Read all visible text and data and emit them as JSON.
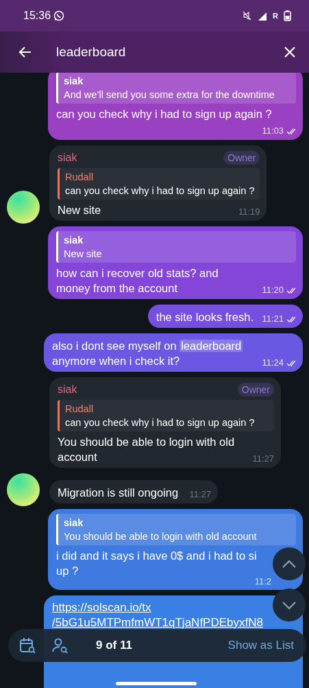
{
  "status_bar": {
    "time": "15:36",
    "carrier": "R"
  },
  "search": {
    "value": "leaderboard"
  },
  "messages": [
    {
      "kind": "outgoing",
      "color": "#9a40c2",
      "reply": {
        "name": "siak",
        "text": "And we’ll send you some extra for the downtime"
      },
      "text": "can you check why i had to sign up again ?",
      "time": "11:03",
      "read": true
    },
    {
      "kind": "incoming",
      "sender": "siak",
      "badge": "Owner",
      "avatar": true,
      "reply": {
        "name": "Rudall",
        "text": "can you check why i had to sign up again ?"
      },
      "text": "New site",
      "time": "11:19"
    },
    {
      "kind": "outgoing",
      "color": "#8446d8",
      "reply": {
        "name": "siak",
        "text": "New site"
      },
      "text": "how can i recover old stats?  and money from the account",
      "time": "11:20",
      "read": true
    },
    {
      "kind": "outgoing",
      "color": "#744fe0",
      "text": "the site looks fresh.",
      "time": "11:21",
      "read": true
    },
    {
      "kind": "outgoing",
      "color": "#6a58e2",
      "text": "also i dont see myself on ",
      "highlight": "leaderboard",
      "text_after": " anymore when i check it?",
      "time": "11:24",
      "read": true
    },
    {
      "kind": "incoming",
      "sender": "siak",
      "badge": "Owner",
      "avatar": false,
      "reply": {
        "name": "Rudall",
        "text": "can you check why i had to sign up again ?"
      },
      "text": "You should be able to login with old account",
      "time": "11:27"
    },
    {
      "kind": "incoming",
      "avatar": true,
      "text": "Migration is still ongoing",
      "time": "11:27"
    },
    {
      "kind": "outgoing",
      "color": "#3f7ae0",
      "reply": {
        "name": "siak",
        "text": "You should be able to login with old account"
      },
      "text": "i did and it says i have 0$ and i had to si\nup ?",
      "time": "11:2"
    },
    {
      "kind": "outgoing",
      "color": "#3a80e4",
      "link": "https://solscan.io/tx\n/5bG1u5MTPmfmWT1qTjaNfPDEbyxfN8"
    }
  ],
  "navigator": {
    "counter": "9 of 11",
    "action": "Show as List"
  }
}
